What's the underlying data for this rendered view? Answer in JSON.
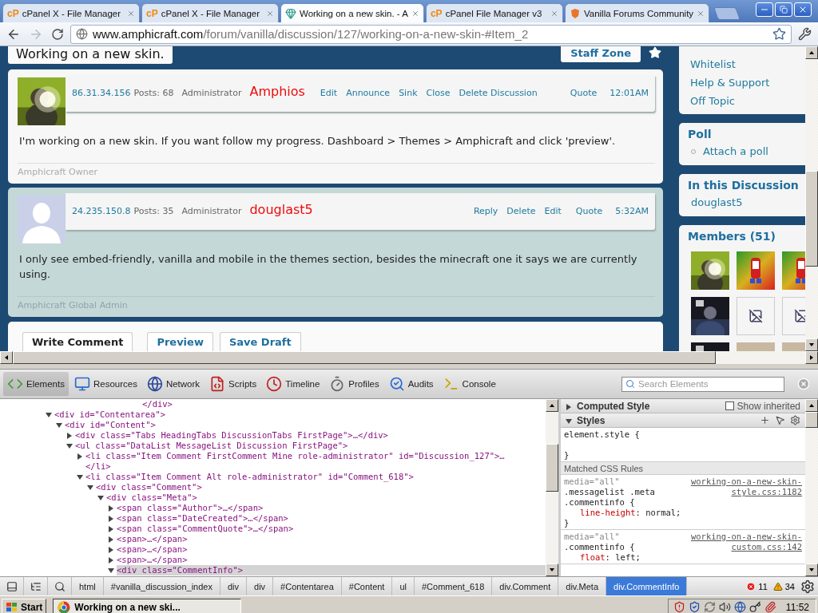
{
  "browser": {
    "tabs": [
      {
        "kind": "cpanel",
        "logo": "cP",
        "title": "cPanel X - File Manager",
        "selected": false
      },
      {
        "kind": "cpanel",
        "logo": "cP",
        "title": "cPanel X - File Manager",
        "selected": false
      },
      {
        "kind": "gem",
        "title": "Working on a new skin. - A",
        "selected": true
      },
      {
        "kind": "cpanel",
        "logo": "cP",
        "title": "cPanel File Manager v3",
        "selected": false
      },
      {
        "kind": "vanilla",
        "title": "Vanilla Forums Community",
        "selected": false
      }
    ],
    "address": {
      "host": "www.amphicraft.com",
      "path": "/forum/vanilla/discussion/127/working-on-a-new-skin-#Item_2"
    }
  },
  "page": {
    "discussion_title": "Working on a new skin.",
    "staff_zone": "Staff Zone",
    "comments": [
      {
        "alt": false,
        "avatar": {
          "kind": "picture"
        },
        "ip": "86.31.34.156",
        "posts": "Posts: 68",
        "role": "Administrator",
        "author": "Amphios",
        "actions": [
          "Edit",
          "Announce",
          "Sink",
          "Close",
          "Delete Discussion"
        ],
        "quote": "Quote",
        "time": "12:01AM",
        "body": "I'm working on a new skin. If you want follow my progress. Dashboard > Themes > Amphicraft and click 'preview'.",
        "signature": "Amphicraft Owner"
      },
      {
        "alt": true,
        "avatar": {
          "kind": "silhouette"
        },
        "ip": "24.235.150.8",
        "posts": "Posts: 35",
        "role": "Administrator",
        "author": "douglast5",
        "actions": [
          "Reply",
          "Delete",
          "Edit"
        ],
        "quote": "Quote",
        "time": "5:32AM",
        "body": "I only see embed-friendly, vanilla and mobile in the themes section, besides the minecraft one it says we are currently using.",
        "signature": "Amphicraft Global Admin"
      }
    ],
    "comment_form": {
      "tabs": [
        {
          "label": "Write Comment",
          "selected": true
        },
        {
          "label": "Preview",
          "selected": false
        },
        {
          "label": "Save Draft",
          "selected": false
        }
      ]
    },
    "sidebar": {
      "categories": [
        "Whitelist",
        "Help & Support",
        "Off Topic"
      ],
      "poll": {
        "title": "Poll",
        "items": [
          "Attach a poll"
        ]
      },
      "in_discussion": {
        "title": "In this Discussion",
        "users": [
          "douglast5"
        ]
      },
      "members": {
        "title": "Members (51)",
        "avatars": [
          {
            "kind": "picture"
          },
          {
            "kind": "picture"
          },
          {
            "kind": "picture"
          },
          {
            "kind": "picture"
          },
          {
            "kind": "broken"
          },
          {
            "kind": "broken"
          },
          {
            "kind": "picture"
          },
          {
            "kind": "picture"
          },
          {
            "kind": "picture"
          }
        ]
      }
    }
  },
  "devtools": {
    "tabs": [
      {
        "kind": "elements",
        "label": "Elements",
        "selected": true
      },
      {
        "kind": "resources",
        "label": "Resources",
        "selected": false
      },
      {
        "kind": "network",
        "label": "Network",
        "selected": false
      },
      {
        "kind": "scripts",
        "label": "Scripts",
        "selected": false
      },
      {
        "kind": "timeline",
        "label": "Timeline",
        "selected": false
      },
      {
        "kind": "profiles",
        "label": "Profiles",
        "selected": false
      },
      {
        "kind": "audits",
        "label": "Audits",
        "selected": false
      },
      {
        "kind": "console",
        "label": "Console",
        "selected": false
      }
    ],
    "search": {
      "placeholder": "Search Elements"
    },
    "dom": [
      {
        "kind": "closing",
        "text": "</div>",
        "selected": false
      },
      {
        "kind": "element",
        "text": "<div id=\"Contentarea\">",
        "expanded": true,
        "selected": false,
        "children": [
          {
            "kind": "element",
            "text": "<div id=\"Content\">",
            "expanded": true,
            "selected": false,
            "children": [
              {
                "kind": "element",
                "text": "<div class=\"Tabs HeadingTabs DiscussionTabs FirstPage\">…</div>",
                "expanded": false,
                "selected": false
              },
              {
                "kind": "element",
                "text": "<ul class=\"DataList MessageList Discussion FirstPage\">",
                "expanded": true,
                "selected": false,
                "children": [
                  {
                    "kind": "element",
                    "text": "<li class=\"Item Comment FirstComment Mine role-administrator\" id=\"Discussion_127\">…</li>",
                    "expanded": false,
                    "selected": false
                  },
                  {
                    "kind": "element",
                    "text": "<li class=\"Item Comment Alt role-administrator\" id=\"Comment_618\">",
                    "expanded": true,
                    "selected": false,
                    "children": [
                      {
                        "kind": "element",
                        "text": "<div class=\"Comment\">",
                        "expanded": true,
                        "selected": false,
                        "children": [
                          {
                            "kind": "element",
                            "text": "<div class=\"Meta\">",
                            "expanded": true,
                            "selected": false,
                            "children": [
                              {
                                "kind": "element",
                                "text": "<span class=\"Author\">…</span>",
                                "expanded": false,
                                "selected": false
                              },
                              {
                                "kind": "element",
                                "text": "<span class=\"DateCreated\">…</span>",
                                "expanded": false,
                                "selected": false
                              },
                              {
                                "kind": "element",
                                "text": "<span class=\"CommentQuote\">…</span>",
                                "expanded": false,
                                "selected": false
                              },
                              {
                                "kind": "element",
                                "text": "<span>…</span>",
                                "expanded": false,
                                "selected": false
                              },
                              {
                                "kind": "element",
                                "text": "<span>…</span>",
                                "expanded": false,
                                "selected": false
                              },
                              {
                                "kind": "element",
                                "text": "<span>…</span>",
                                "expanded": false,
                                "selected": false
                              },
                              {
                                "kind": "element",
                                "text": "<div class=\"CommentInfo\">",
                                "expanded": true,
                                "selected": true
                              }
                            ]
                          }
                        ]
                      }
                    ]
                  }
                ]
              }
            ]
          }
        ]
      }
    ],
    "styles": {
      "computed": {
        "title": "Computed Style",
        "expanded": false
      },
      "show_inherited": {
        "label": "Show inherited",
        "checked": false
      },
      "styles_section": {
        "title": "Styles",
        "expanded": true
      },
      "element_style": [
        "element.style {",
        "}"
      ],
      "matched_title": "Matched CSS Rules",
      "rules": [
        {
          "media": "media=\"all\"",
          "source": [
            "working-on-a-new-skin-",
            "style.css:1182"
          ],
          "selector": [
            ".messagelist .meta",
            ".commentinfo {"
          ],
          "props": [
            {
              "name": "line-height",
              "value": ": normal;"
            }
          ],
          "close": "}"
        },
        {
          "media": "media=\"all\"",
          "source": [
            "working-on-a-new-skin-",
            "custom.css:142"
          ],
          "selector": [
            ".commentinfo {"
          ],
          "props": [
            {
              "name": "float",
              "value": ": left;"
            }
          ]
        }
      ]
    },
    "breadcrumbs": [
      {
        "label": "html",
        "selected": false
      },
      {
        "label": "#vanilla_discussion_index",
        "selected": false
      },
      {
        "label": "div",
        "selected": false
      },
      {
        "label": "div",
        "selected": false
      },
      {
        "label": "#Contentarea",
        "selected": false
      },
      {
        "label": "#Content",
        "selected": false
      },
      {
        "label": "ul",
        "selected": false
      },
      {
        "label": "#Comment_618",
        "selected": false
      },
      {
        "label": "div.Comment",
        "selected": false
      },
      {
        "label": "div.Meta",
        "selected": false
      },
      {
        "label": "div.CommentInfo",
        "selected": true
      }
    ],
    "errors": "11",
    "warnings": "34"
  },
  "taskbar": {
    "start": "Start",
    "tasks": [
      {
        "title": "Working on a new ski...",
        "selected": true
      }
    ],
    "clock": "11:52"
  }
}
